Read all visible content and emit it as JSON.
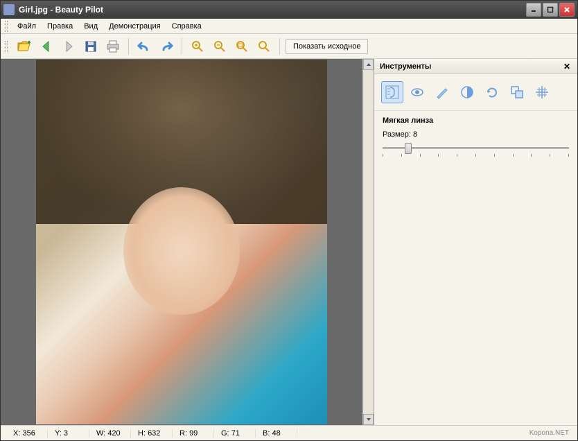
{
  "titlebar": {
    "text": "Girl.jpg - Beauty Pilot"
  },
  "menu": {
    "file": "Файл",
    "edit": "Правка",
    "view": "Вид",
    "demo": "Демонстрация",
    "help": "Справка"
  },
  "toolbar": {
    "show_original": "Показать исходное"
  },
  "panel": {
    "title": "Инструменты",
    "section_title": "Мягкая линза",
    "size_label": "Размер:",
    "size_value": "8"
  },
  "status": {
    "x_label": "X:",
    "x_val": "356",
    "y_label": "Y:",
    "y_val": "3",
    "w_label": "W:",
    "w_val": "420",
    "h_label": "H:",
    "h_val": "632",
    "r_label": "R:",
    "r_val": "99",
    "g_label": "G:",
    "g_val": "71",
    "b_label": "B:",
    "b_val": "48"
  },
  "watermark": "Kopona.NET"
}
